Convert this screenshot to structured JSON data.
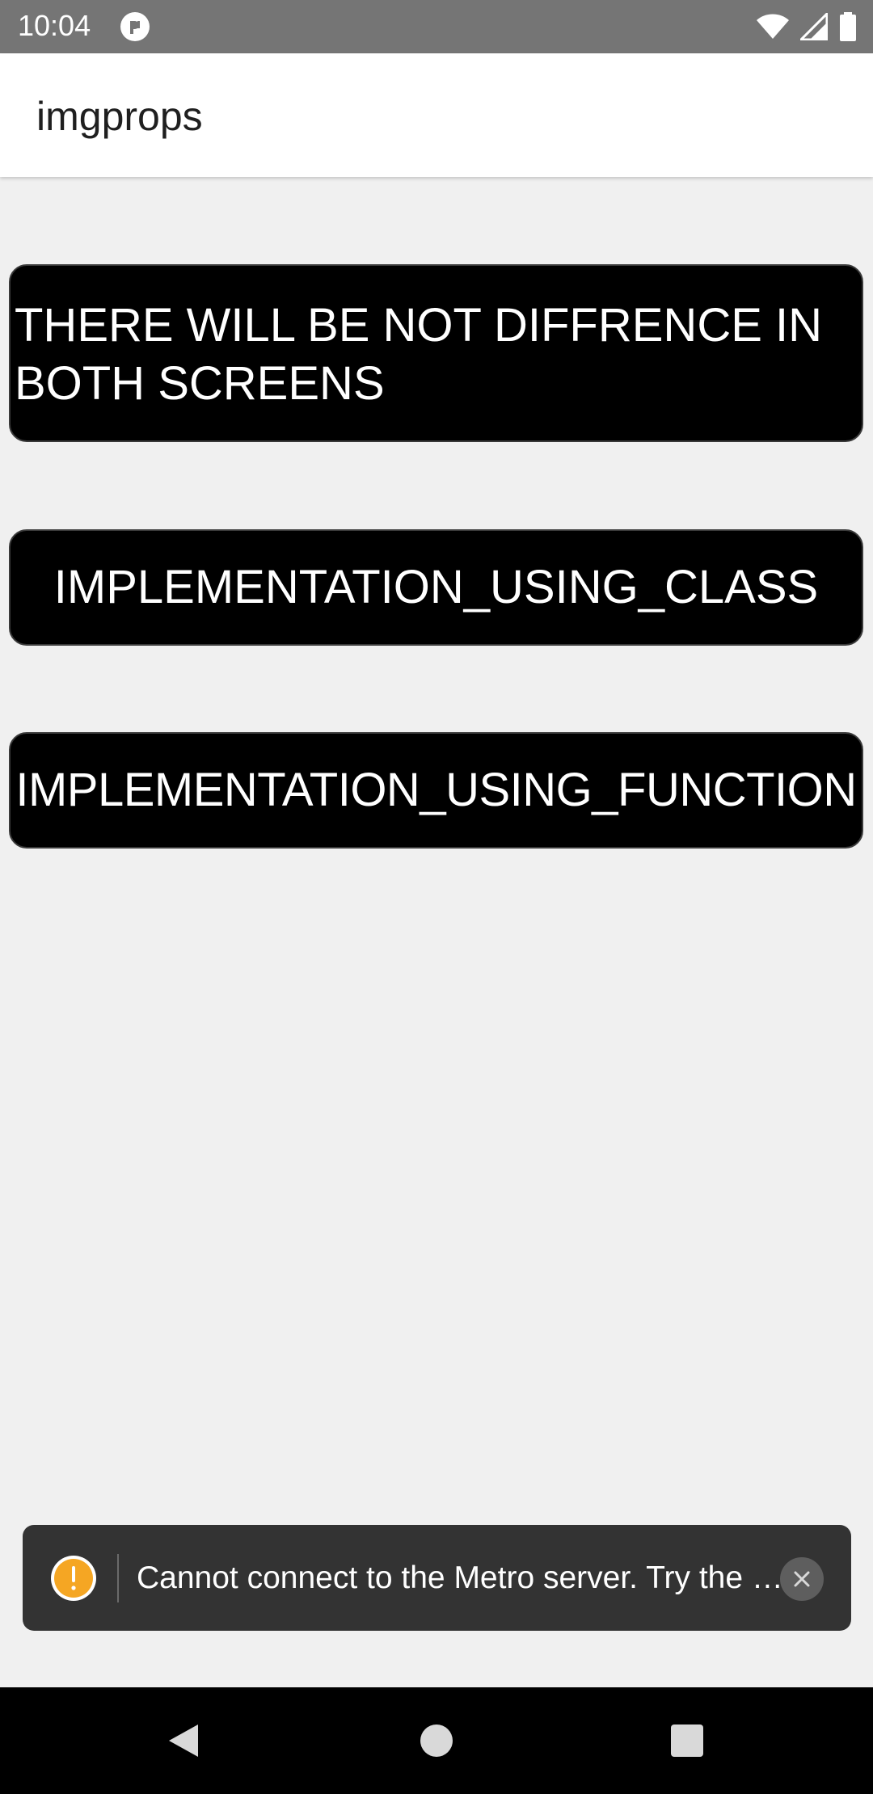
{
  "status_bar": {
    "time": "10:04",
    "icons": [
      "app-notification-icon",
      "wifi-icon",
      "cell-signal-icon",
      "battery-icon"
    ]
  },
  "app_bar": {
    "title": "imgprops"
  },
  "buttons": {
    "notice_label": "THERE WILL BE NOT DIFFRENCE IN BOTH SCREENS",
    "class_label": "IMPLEMENTATION_USING_CLASS",
    "function_label": "IMPLEMENTATION_USING_FUNCTION"
  },
  "toast": {
    "message": "Cannot connect to the Metro server.  Try the following to fix the issue:",
    "icon": "warning-icon",
    "accent_color": "#F5A623"
  },
  "nav_bar": {
    "icons": [
      "back-icon",
      "home-icon",
      "recents-icon"
    ]
  },
  "colors": {
    "status_bar": "#757575",
    "background": "#F0F0F0",
    "button": "#000000",
    "toast": "#333333"
  }
}
